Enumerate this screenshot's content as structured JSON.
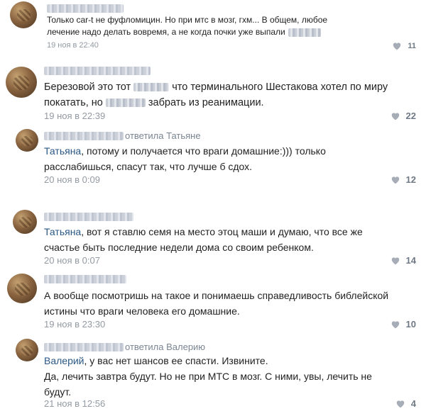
{
  "comments": [
    {
      "text1": "Только car-t не фуфломицин. Но при мтс в мозг, гхм... В общем, любое",
      "text2": "лечение надо делать вовремя, а не когда почки уже выпали",
      "date": "19 ноя в 22:40",
      "likes": "11"
    },
    {
      "text1a": "Березовой это тот",
      "text1b": "что терминального Шестакова хотел по миру",
      "text2a": "покатать, но",
      "text2b": "забрать из реанимации.",
      "date": "19 ноя в 22:39",
      "likes": "22"
    },
    {
      "reply_to": "ответила Татьяне",
      "mention": "Татьяна",
      "text1": ", потому и получается что враги домашние:))) только",
      "text2": "расслабишься, спасут так, что лучше б сдох.",
      "date": "20 ноя в 0:09",
      "likes": "12"
    },
    {
      "mention": "Татьяна",
      "text1": ", вот я ставлю семя на место этоц маши и думаю, что все же",
      "text2": "счастье быть последние недели дома со своим ребенком.",
      "date": "20 ноя в 0:07",
      "likes": "14"
    },
    {
      "text1": "А вообще посмотришь на такое и понимаешь справедливость библейской",
      "text2": "истины что враги человека его домашние.",
      "date": "19 ноя в 23:30",
      "likes": "10"
    },
    {
      "reply_to": "ответила Валерию",
      "mention": "Валерий",
      "text1": ", у вас нет шансов ее спасти. Извините.",
      "text2": "Да, лечить завтра будут. Но не при МТС в мозг. С ними, увы, лечить не",
      "text3": "будут.",
      "date": "21 ноя в 12:56",
      "likes": "4"
    }
  ],
  "colors": {
    "link": "#2a5885",
    "meta": "#939aa3",
    "text": "#222222"
  },
  "icons": {
    "like": "heart-icon",
    "avatar": "avatar"
  }
}
